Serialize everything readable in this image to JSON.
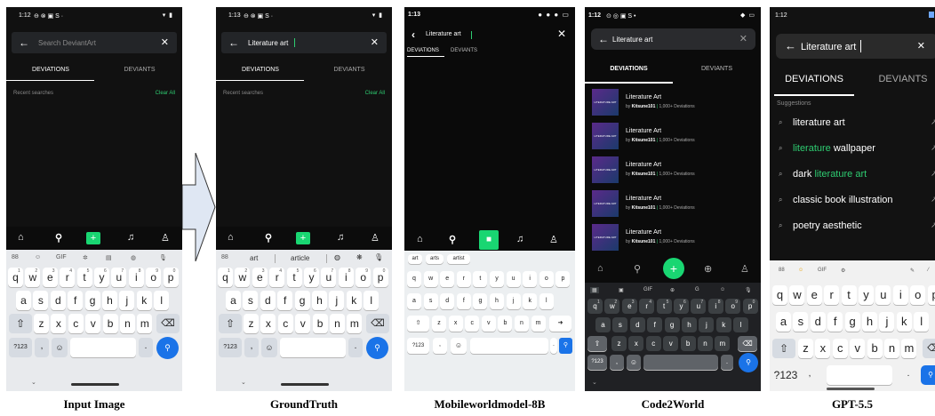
{
  "captions": [
    "Input Image",
    "GroundTruth",
    "Mobileworldmodel-8B",
    "Code2World",
    "GPT-5.5"
  ],
  "input": {
    "time": "1:12",
    "status_icons": "⊖ ⊗ ▣ S ·",
    "status_right": "▾ ▮",
    "placeholder": "Search DeviantArt",
    "tab1": "DEVIATIONS",
    "tab2": "DEVIANTS",
    "recent": "Recent searches",
    "clear": "Clear All"
  },
  "gt": {
    "time": "1:13",
    "status_icons": "⊖ ⊗ ▣ S ·",
    "status_right": "▾ ▮",
    "query": "Literature art",
    "tab1": "DEVIATIONS",
    "tab2": "DEVIANTS",
    "recent": "Recent searches",
    "clear": "Clear All",
    "suggestions": [
      "art",
      "article"
    ]
  },
  "keyboard": {
    "row1": [
      "q",
      "w",
      "e",
      "r",
      "t",
      "y",
      "u",
      "i",
      "o",
      "p"
    ],
    "row1_nums": [
      "1",
      "2",
      "3",
      "4",
      "5",
      "6",
      "7",
      "8",
      "9",
      "0"
    ],
    "row2": [
      "a",
      "s",
      "d",
      "f",
      "g",
      "h",
      "j",
      "k",
      "l"
    ],
    "row3": [
      "z",
      "x",
      "c",
      "v",
      "b",
      "n",
      "m"
    ],
    "numkey": "?123",
    "comma": ",",
    "period": ".",
    "toolbar": [
      "88",
      "☺",
      "GIF",
      "✲",
      "▤",
      "◍",
      "🎙"
    ]
  },
  "mwm": {
    "time": "1:13",
    "query": "Literature art",
    "tab1": "DEVIATIONS",
    "tab2": "DEVIANTS",
    "suggestions": [
      "art",
      "arts",
      "artist"
    ],
    "numkey": "?123"
  },
  "c2w": {
    "time": "1:12",
    "status_icons": "⊙ ◎ ▣ S •",
    "query": "Literature art",
    "tab1": "DEVIATIONS",
    "tab2": "DEVIANTS",
    "results": [
      {
        "title": "Literature Art",
        "by": "by",
        "user": "Kitsune101",
        "count": "1,000+ Deviations"
      },
      {
        "title": "Literature Art",
        "by": "by",
        "user": "Kitsune101",
        "count": "1,000+ Deviations"
      },
      {
        "title": "Literature Art",
        "by": "by",
        "user": "Kitsune101",
        "count": "1,000+ Deviations"
      },
      {
        "title": "Literature Art",
        "by": "by",
        "user": "Kitsune101",
        "count": "1,000+ Deviations"
      },
      {
        "title": "Literature Art",
        "by": "by",
        "user": "Kitsune101",
        "count": "1,000+ Deviations"
      }
    ],
    "thumb_text": "LITERATURE ART",
    "numkey": "?123"
  },
  "gpt": {
    "time": "1:12",
    "query": "Literature art",
    "tab1": "DEVIATIONS",
    "tab2": "DEVIANTS",
    "suggestions_label": "Suggestions",
    "suggestions": [
      {
        "pre": "",
        "hl": "",
        "post": "literature art"
      },
      {
        "pre": "",
        "hl": "literature",
        "post": " wallpaper"
      },
      {
        "pre": "dark ",
        "hl": "literature art",
        "post": ""
      },
      {
        "pre": "",
        "hl": "",
        "post": "classic book illustration"
      },
      {
        "pre": "",
        "hl": "",
        "post": "poetry aesthetic"
      }
    ],
    "toolbar": [
      "88",
      "☺",
      "GIF",
      "⚙"
    ],
    "numkey": "?123"
  }
}
